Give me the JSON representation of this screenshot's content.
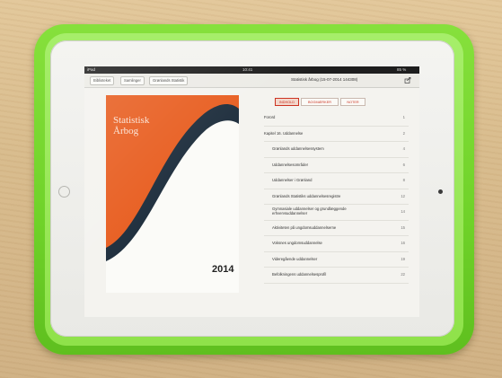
{
  "status": {
    "left": "iPad",
    "time": "10:41",
    "right": "85 %"
  },
  "nav": {
    "crumbs": [
      "Biblioteket",
      "Samlinger",
      "Grønlands Statistik"
    ],
    "title": "Statistisk årbog (15-07-2014 144308)"
  },
  "cover": {
    "title_line1": "Statistisk",
    "title_line2": "Årbog",
    "year": "2014",
    "orange": "#e85f22",
    "navy": "#1f2f3e"
  },
  "tabs": [
    "INDHOLD",
    "BOGMÆRKER",
    "NOTER"
  ],
  "toc": [
    {
      "label": "Forord",
      "page": "1",
      "indent": false
    },
    {
      "label": "Kapitel 16. Uddannelse",
      "page": "2",
      "indent": false
    },
    {
      "label": "Grønlands uddannelsessystem",
      "page": "4",
      "indent": true
    },
    {
      "label": "Uddannelsesområder",
      "page": "6",
      "indent": true
    },
    {
      "label": "Uddannelser i Grønland",
      "page": "8",
      "indent": true
    },
    {
      "label": "Grønlands Statistiks uddannelsesregistre",
      "page": "12",
      "indent": true
    },
    {
      "label": "Gymnasiale uddannelser og grundlæggende erhvervsuddannelser",
      "page": "14",
      "indent": true
    },
    {
      "label": "Aktiviteten på ungdomsuddannelserne",
      "page": "15",
      "indent": true
    },
    {
      "label": "Voksnes ungdomsuddannelse",
      "page": "16",
      "indent": true
    },
    {
      "label": "Videregående uddannelser",
      "page": "19",
      "indent": true
    },
    {
      "label": "Befolkningens uddannelsesprofil",
      "page": "22",
      "indent": true
    }
  ]
}
